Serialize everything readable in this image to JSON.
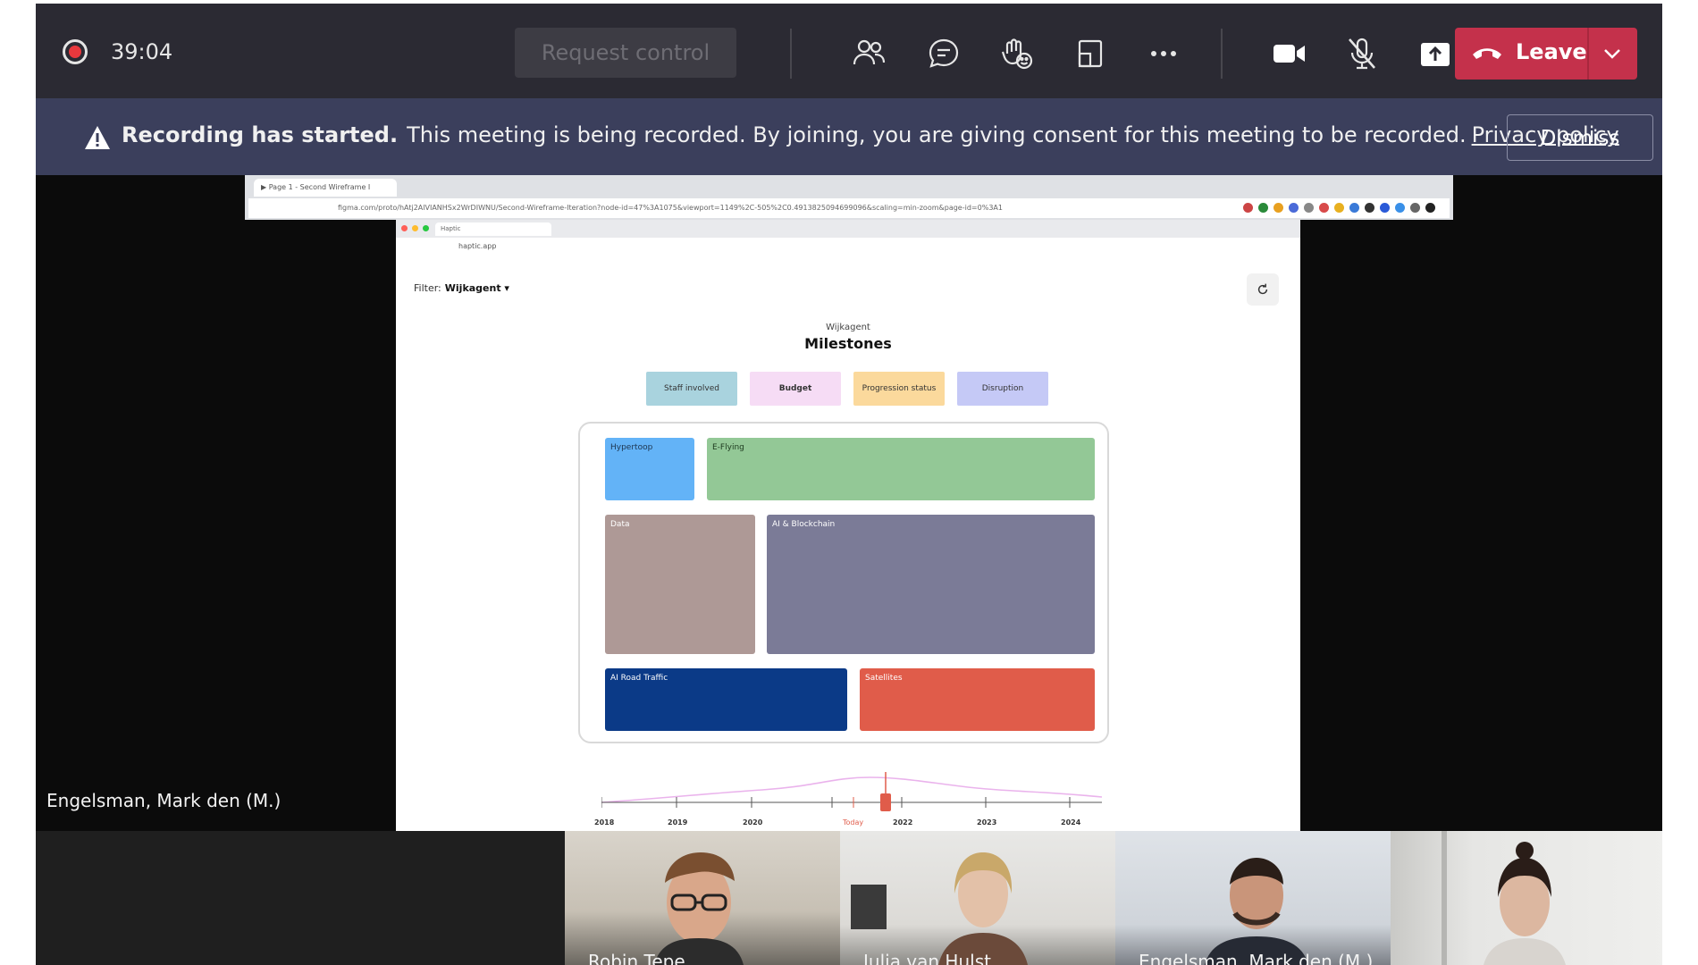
{
  "meeting": {
    "timer": "39:04",
    "request_control": "Request control",
    "leave_label": "Leave"
  },
  "banner": {
    "bold": "Recording has started.",
    "text": "This meeting is being recorded. By joining, you are giving consent for this meeting to be recorded.",
    "link": "Privacy policy",
    "dismiss": "Dismiss"
  },
  "shared": {
    "outer_tab": "▶ Page 1 - Second Wireframe I",
    "outer_url": "figma.com/proto/hAtj2AlVIANHSx2WrDIWNU/Second-Wireframe-Iteration?node-id=47%3A1075&viewport=1149%2C-505%2C0.4913825094699096&scaling=min-zoom&page-id=0%3A1",
    "inner_tab": "Haptic",
    "inner_url": "haptic.app",
    "filter_label": "Filter:",
    "filter_value": "Wijkagent ▾",
    "subtitle": "Wijkagent",
    "title": "Milestones",
    "pills": [
      "Staff involved",
      "Budget",
      "Progression status",
      "Disruption"
    ],
    "tiles": [
      "Hypertoop",
      "E-Flying",
      "Data",
      "AI & Blockchain",
      "AI Road Traffic",
      "Satellites"
    ],
    "timeline_years": [
      "2018",
      "2019",
      "2020",
      "Today",
      "2022",
      "2023",
      "2024"
    ]
  },
  "speaker_name": "Engelsman, Mark den (M.)",
  "participants": [
    "Robin Tepe",
    "Julia van Hulst",
    "Engelsman, Mark den (M.)",
    ""
  ],
  "colors": {
    "leave": "#c4314b",
    "banner": "#3b3f5c",
    "tile_hypertoop": "#63b3f7",
    "tile_eflying": "#93c896",
    "tile_data": "#ae9996",
    "tile_ai_blockchain": "#7b7b97",
    "tile_road": "#0b3a87",
    "tile_satellites": "#e05c4a"
  },
  "icons": [
    "record-icon",
    "people-icon",
    "chat-icon",
    "reactions-icon",
    "rooms-icon",
    "more-icon",
    "camera-icon",
    "mic-off-icon",
    "share-icon",
    "phone-icon",
    "chevron-down-icon",
    "warning-icon",
    "refresh-icon"
  ]
}
